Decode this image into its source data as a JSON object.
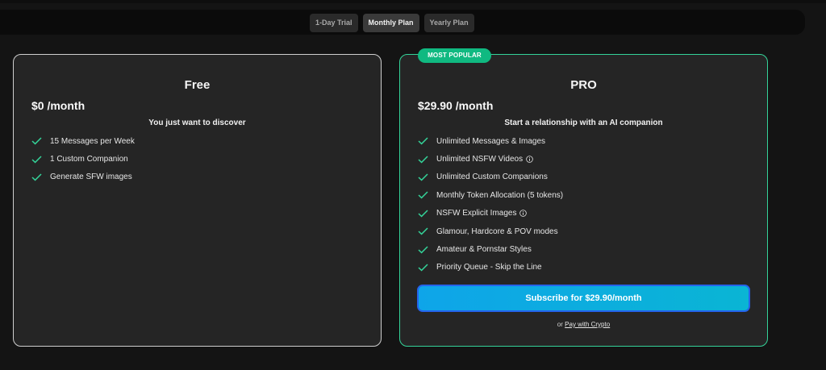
{
  "tabs": [
    {
      "label": "1-Day Trial",
      "active": false
    },
    {
      "label": "Monthly Plan",
      "active": true
    },
    {
      "label": "Yearly Plan",
      "active": false
    }
  ],
  "free": {
    "title": "Free",
    "price": "$0 /month",
    "tagline": "You just want to discover",
    "features": [
      {
        "label": "15 Messages per Week",
        "icon": "check-icon"
      },
      {
        "label": "1 Custom Companion",
        "icon": "check-icon"
      },
      {
        "label": "Generate SFW images",
        "icon": "check-icon"
      }
    ]
  },
  "pro": {
    "badge": "MOST POPULAR",
    "title": "PRO",
    "price": "$29.90 /month",
    "tagline": "Start a relationship with an AI companion",
    "features": [
      {
        "label": "Unlimited Messages & Images",
        "info": false
      },
      {
        "label": "Unlimited NSFW Videos",
        "info": true
      },
      {
        "label": "Unlimited Custom Companions",
        "info": false
      },
      {
        "label": "Monthly Token Allocation (5 tokens)",
        "info": false
      },
      {
        "label": "NSFW Explicit Images",
        "info": true
      },
      {
        "label": "Glamour, Hardcore & POV modes",
        "info": false
      },
      {
        "label": "Amateur & Pornstar Styles",
        "info": false
      },
      {
        "label": "Priority Queue - Skip the Line",
        "info": false
      }
    ],
    "subscribe_label": "Subscribe for $29.90/month",
    "or_text": "or",
    "crypto_link": "Pay with Crypto"
  },
  "colors": {
    "accent_green": "#10b981",
    "check_green": "#34d399",
    "button_gradient_start": "#0ea5e9",
    "button_gradient_end": "#0ab5d4",
    "button_border": "#2563eb"
  }
}
